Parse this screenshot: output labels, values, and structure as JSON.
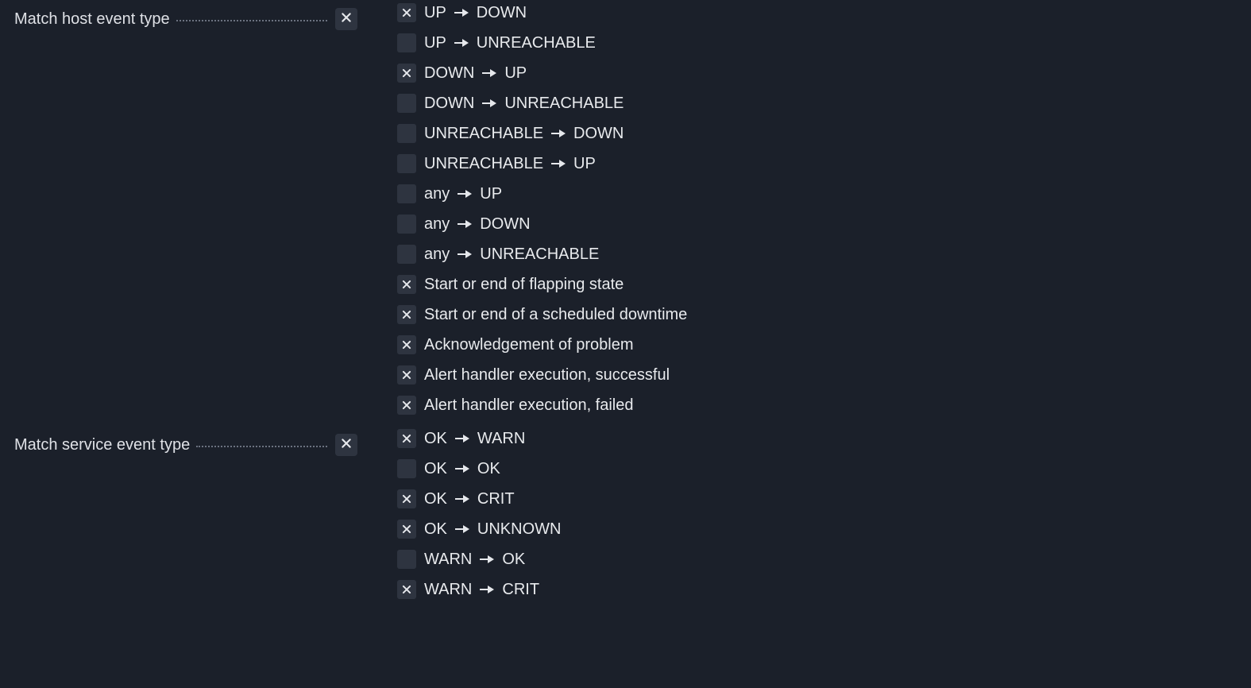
{
  "sections": [
    {
      "id": "host",
      "label": "Match host event type",
      "options": [
        {
          "checked": true,
          "type": "transition",
          "from": "UP",
          "to": "DOWN"
        },
        {
          "checked": false,
          "type": "transition",
          "from": "UP",
          "to": "UNREACHABLE"
        },
        {
          "checked": true,
          "type": "transition",
          "from": "DOWN",
          "to": "UP"
        },
        {
          "checked": false,
          "type": "transition",
          "from": "DOWN",
          "to": "UNREACHABLE"
        },
        {
          "checked": false,
          "type": "transition",
          "from": "UNREACHABLE",
          "to": "DOWN"
        },
        {
          "checked": false,
          "type": "transition",
          "from": "UNREACHABLE",
          "to": "UP"
        },
        {
          "checked": false,
          "type": "transition",
          "from": "any",
          "to": "UP"
        },
        {
          "checked": false,
          "type": "transition",
          "from": "any",
          "to": "DOWN"
        },
        {
          "checked": false,
          "type": "transition",
          "from": "any",
          "to": "UNREACHABLE"
        },
        {
          "checked": true,
          "type": "text",
          "text": "Start or end of flapping state"
        },
        {
          "checked": true,
          "type": "text",
          "text": "Start or end of a scheduled downtime"
        },
        {
          "checked": true,
          "type": "text",
          "text": "Acknowledgement of problem"
        },
        {
          "checked": true,
          "type": "text",
          "text": "Alert handler execution, successful"
        },
        {
          "checked": true,
          "type": "text",
          "text": "Alert handler execution, failed"
        }
      ]
    },
    {
      "id": "service",
      "label": "Match service event type",
      "options": [
        {
          "checked": true,
          "type": "transition",
          "from": "OK",
          "to": "WARN"
        },
        {
          "checked": false,
          "type": "transition",
          "from": "OK",
          "to": "OK"
        },
        {
          "checked": true,
          "type": "transition",
          "from": "OK",
          "to": "CRIT"
        },
        {
          "checked": true,
          "type": "transition",
          "from": "OK",
          "to": "UNKNOWN"
        },
        {
          "checked": false,
          "type": "transition",
          "from": "WARN",
          "to": "OK"
        },
        {
          "checked": true,
          "type": "transition",
          "from": "WARN",
          "to": "CRIT"
        }
      ]
    }
  ]
}
